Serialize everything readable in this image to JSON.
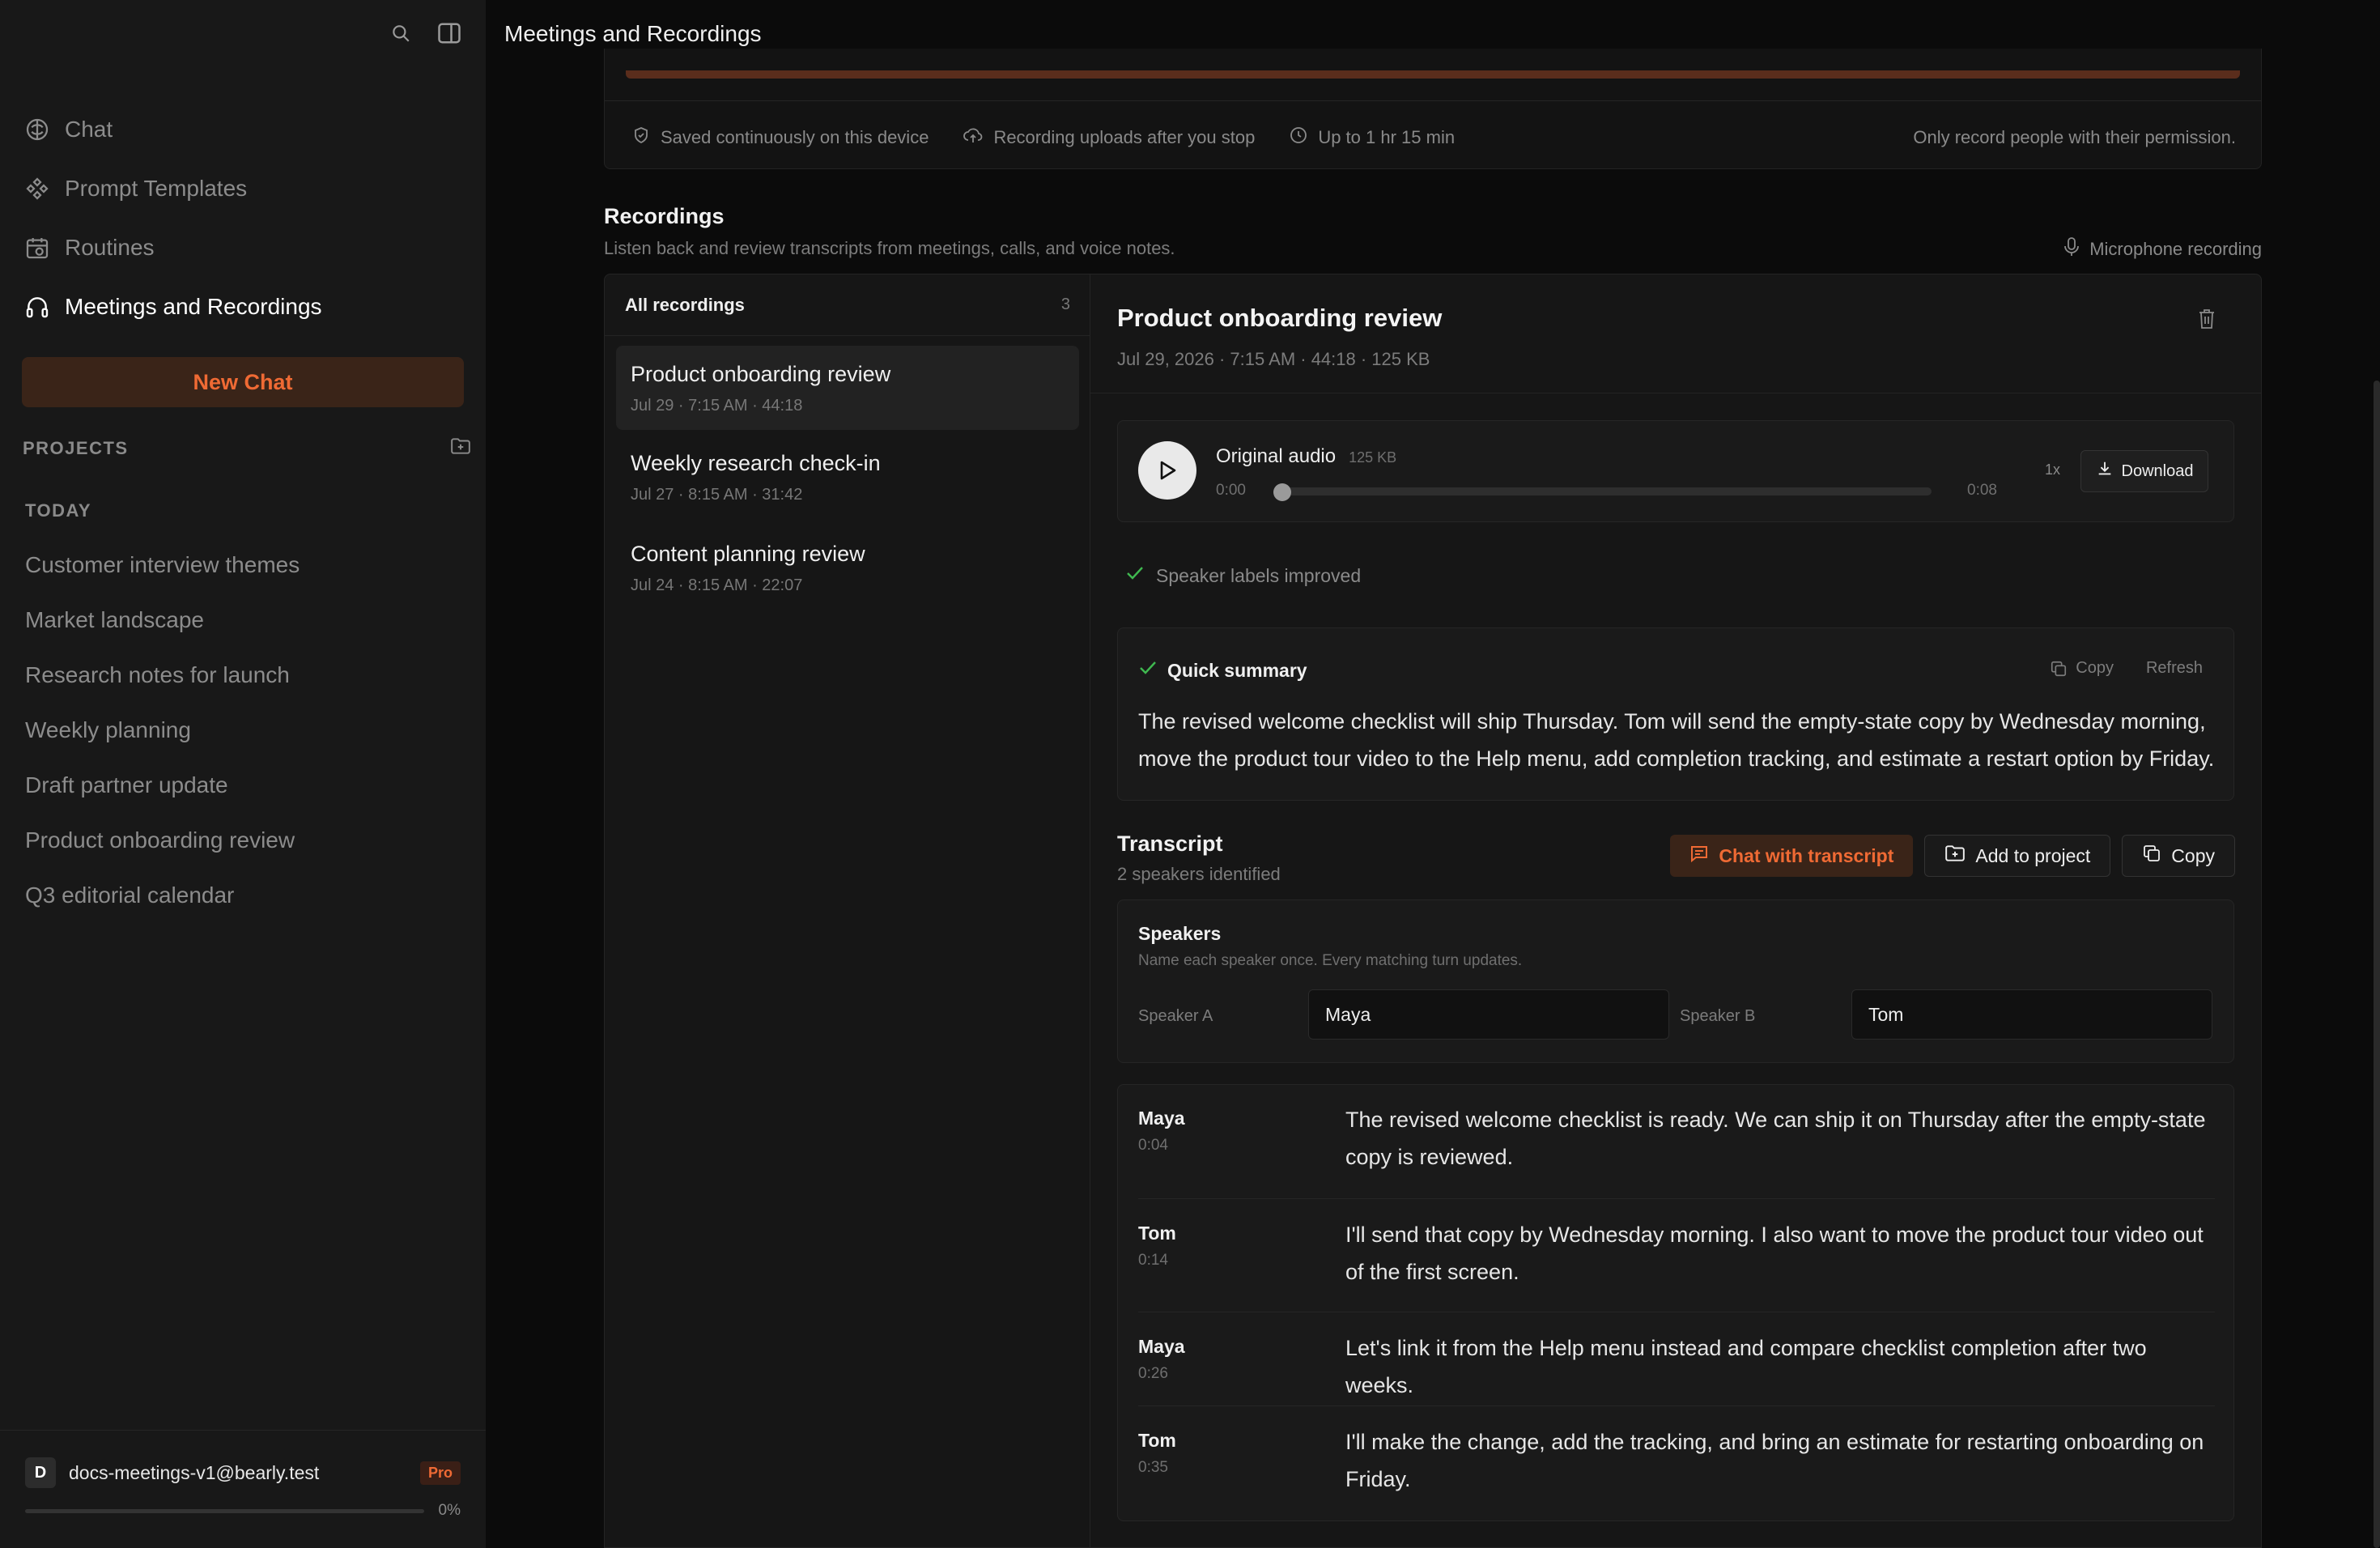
{
  "sidebar": {
    "nav": [
      {
        "label": "Chat",
        "icon": "chat-icon"
      },
      {
        "label": "Prompt Templates",
        "icon": "prompt-templates-icon"
      },
      {
        "label": "Routines",
        "icon": "routines-icon"
      },
      {
        "label": "Meetings and Recordings",
        "icon": "headphones-icon",
        "active": true
      }
    ],
    "new_chat_label": "New Chat",
    "projects_label": "PROJECTS",
    "today_label": "TODAY",
    "projects": [
      "Customer interview themes",
      "Market landscape",
      "Research notes for launch",
      "Weekly planning",
      "Draft partner update",
      "Product onboarding review",
      "Q3 editorial calendar"
    ],
    "user": {
      "initial": "D",
      "email": "docs-meetings-v1@bearly.test",
      "plan": "Pro",
      "usage_percent": 0,
      "usage_label": "0%"
    }
  },
  "header": {
    "title": "Meetings and Recordings"
  },
  "recorder_info": {
    "items": [
      {
        "icon": "shield-check-icon",
        "label": "Saved continuously on this device"
      },
      {
        "icon": "cloud-upload-icon",
        "label": "Recording uploads after you stop"
      },
      {
        "icon": "clock-icon",
        "label": "Up to 1 hr 15 min"
      }
    ],
    "note": "Only record people with their permission."
  },
  "recordings": {
    "title": "Recordings",
    "subtitle": "Listen back and review transcripts from meetings, calls, and voice notes.",
    "mic_label": "Microphone recording",
    "list_title": "All recordings",
    "count": "3",
    "items": [
      {
        "title": "Product onboarding review",
        "meta": "Jul 29 · 7:15 AM · 44:18",
        "selected": true
      },
      {
        "title": "Weekly research check-in",
        "meta": "Jul 27 · 8:15 AM · 31:42"
      },
      {
        "title": "Content planning review",
        "meta": "Jul 24 · 8:15 AM · 22:07"
      }
    ]
  },
  "detail": {
    "title": "Product onboarding review",
    "meta": "Jul 29, 2026 · 7:15 AM · 44:18 · 125 KB",
    "audio": {
      "title": "Original audio",
      "size": "125 KB",
      "current": "0:00",
      "duration": "0:08",
      "progress": 0,
      "speed": "1x",
      "download_label": "Download"
    },
    "speaker_status": "Speaker labels improved",
    "summary": {
      "title": "Quick summary",
      "copy_label": "Copy",
      "refresh_label": "Refresh",
      "text": "The revised welcome checklist will ship Thursday. Tom will send the empty-state copy by Wednesday morning, move the product tour video to the Help menu, add completion tracking, and estimate a restart option by Friday."
    },
    "transcript": {
      "title": "Transcript",
      "subtitle": "2 speakers identified",
      "chat_label": "Chat with transcript",
      "add_project_label": "Add to project",
      "copy_label": "Copy",
      "speakers_title": "Speakers",
      "speakers_hint": "Name each speaker once. Every matching turn updates.",
      "speaker_a_label": "Speaker A",
      "speaker_a_value": "Maya",
      "speaker_b_label": "Speaker B",
      "speaker_b_value": "Tom",
      "turns": [
        {
          "speaker": "Maya",
          "time": "0:04",
          "text": "The revised welcome checklist is ready. We can ship it on Thursday after the empty-state copy is reviewed."
        },
        {
          "speaker": "Tom",
          "time": "0:14",
          "text": "I'll send that copy by Wednesday morning. I also want to move the product tour video out of the first screen."
        },
        {
          "speaker": "Maya",
          "time": "0:26",
          "text": "Let's link it from the Help menu instead and compare checklist completion after two weeks."
        },
        {
          "speaker": "Tom",
          "time": "0:35",
          "text": "I'll make the change, add the tracking, and bring an estimate for restarting onboarding on Friday."
        }
      ]
    }
  },
  "colors": {
    "accent": "#ef6a34",
    "accent_bg": "#3a2418",
    "success": "#3fb950"
  }
}
